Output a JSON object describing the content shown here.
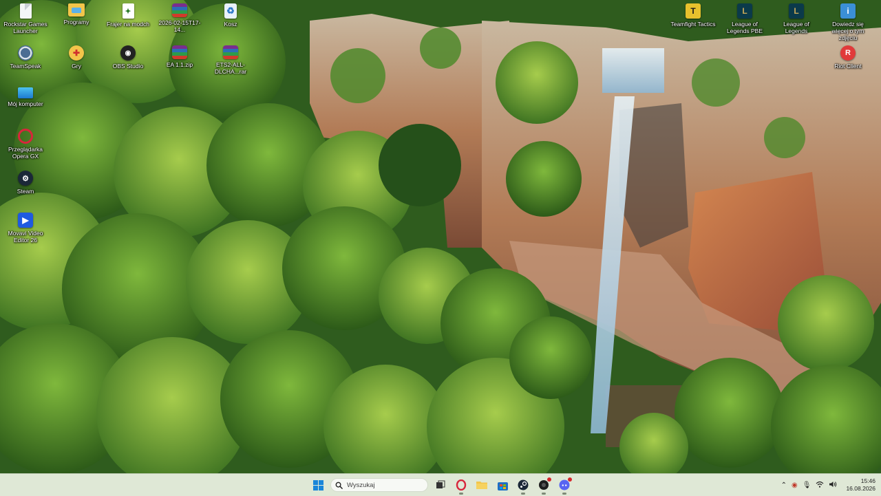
{
  "desktop": {
    "icons_left": [
      {
        "label": "Rockstar Games Launcher",
        "icon": "file-icon"
      },
      {
        "label": "Programy",
        "icon": "folder-icon"
      },
      {
        "label": "Frajer na modch",
        "icon": "cheat-file-icon"
      },
      {
        "label": "2026-02-15T17-14...",
        "icon": "rar-archive-icon"
      },
      {
        "label": "Kosz",
        "icon": "recycle-bin-icon"
      },
      {
        "label": "TeamSpeak",
        "icon": "teamspeak-icon"
      },
      {
        "label": "Gry",
        "icon": "games-folder-icon"
      },
      {
        "label": "OBS Studio",
        "icon": "obs-icon"
      },
      {
        "label": "EA 1.1.zip",
        "icon": "rar-archive-icon"
      },
      {
        "label": "ETS2-ALL-DLCHA...rar",
        "icon": "rar-archive-icon"
      },
      {
        "label": "Mój komputer",
        "icon": "computer-icon"
      },
      {
        "label": "Przeglądarka Opera GX",
        "icon": "opera-gx-icon"
      },
      {
        "label": "Steam",
        "icon": "steam-icon"
      },
      {
        "label": "Movavi Video Editor 26",
        "icon": "movavi-icon"
      }
    ],
    "icons_right": [
      {
        "label": "Teamfight Tactics",
        "icon": "tft-icon"
      },
      {
        "label": "League of Legends PBE",
        "icon": "lol-icon"
      },
      {
        "label": "League of Legends",
        "icon": "lol-icon"
      },
      {
        "label": "Dowiedz się więcej o tym zdjęciu",
        "icon": "info-icon"
      },
      {
        "label": "Riot Client",
        "icon": "riot-icon"
      }
    ]
  },
  "taskbar": {
    "search_placeholder": "Wyszukaj",
    "apps": [
      "start-icon",
      "search-icon",
      "task-view-icon",
      "opera-gx-icon",
      "file-explorer-icon",
      "store-icon",
      "steam-icon",
      "app-icon",
      "discord-icon"
    ],
    "time": "15:46",
    "date": "16.08.2026"
  },
  "colors": {
    "taskbar_bg": "#dfe8d6",
    "accent": "#1a86d9"
  }
}
